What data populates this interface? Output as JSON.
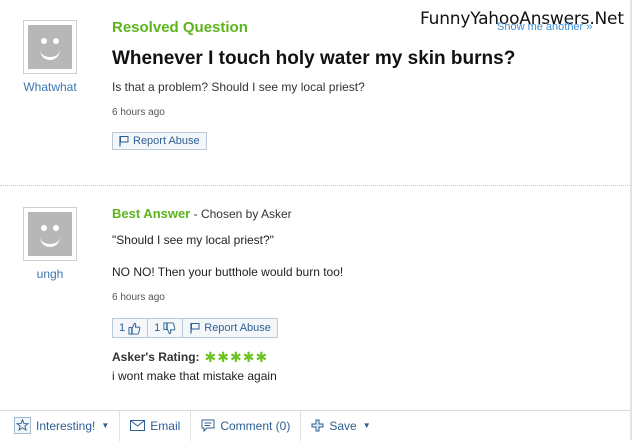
{
  "watermark": "FunnyYahooAnswers.Net",
  "header": {
    "show_another": "Show me another »"
  },
  "question": {
    "section_label": "Resolved Question",
    "title": "Whenever I touch holy water my skin burns?",
    "body": "Is that a problem? Should I see my local priest?",
    "timestamp": "6 hours ago",
    "asker": "Whatwhat",
    "report_label": "Report Abuse"
  },
  "answer": {
    "section_label": "Best Answer",
    "chosen_by": " - Chosen by Asker",
    "quote": "\"Should I see my local priest?\"",
    "text": "NO NO! Then your butthole would burn too!",
    "timestamp": "6 hours ago",
    "answerer": "ungh",
    "thumbs_up_count": "1",
    "thumbs_down_count": "1",
    "report_label": "Report Abuse",
    "rating_label": "Asker's Rating:",
    "rating_stars": 5,
    "rating_max": 5,
    "rating_comment": "i wont make that mistake again"
  },
  "toolbar": {
    "interesting": "Interesting!",
    "email": "Email",
    "comment": "Comment (0)",
    "save": "Save"
  },
  "colors": {
    "section_green": "#5cb41e",
    "link_blue": "#2d5f94",
    "star_green": "#6cc322"
  }
}
